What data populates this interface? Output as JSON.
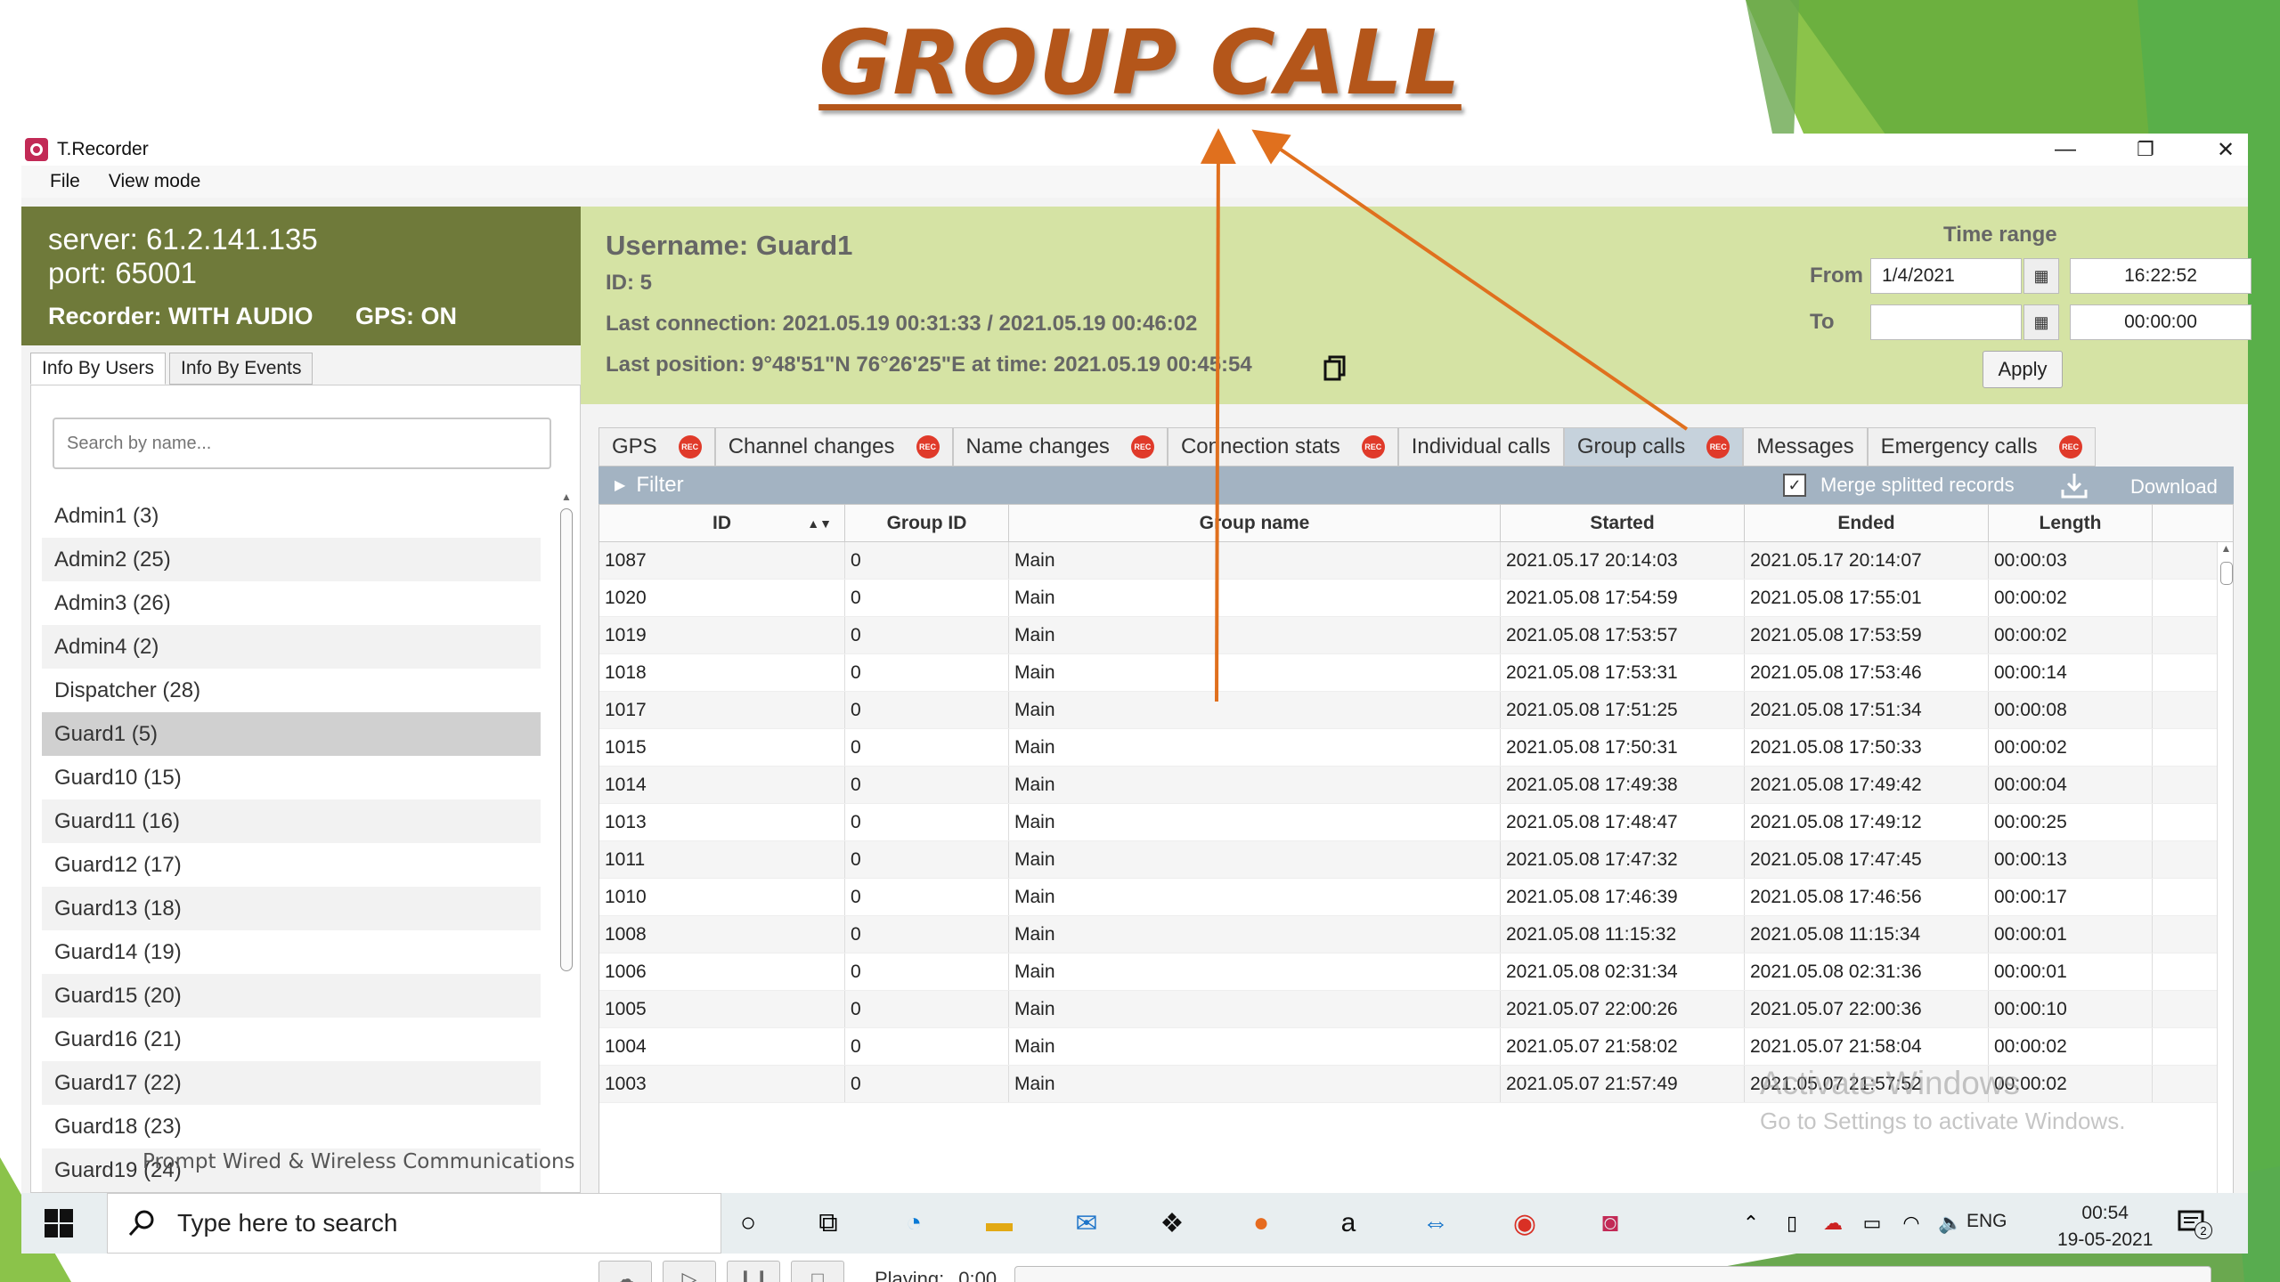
{
  "slide": {
    "title": "GROUP CALL",
    "accent_color": "#b4561a",
    "green_colors": [
      "#8bc34a",
      "#6aa84f",
      "#4caf50"
    ]
  },
  "window": {
    "title": "T.Recorder",
    "minimize": "—",
    "restore": "❐",
    "close": "✕"
  },
  "menu": {
    "items": [
      "File",
      "View mode"
    ]
  },
  "server": {
    "address": "server: 61.2.141.135",
    "port": "port: 65001",
    "recorder": "Recorder: WITH AUDIO",
    "gps": "GPS: ON"
  },
  "left_tabs": [
    "Info By Users",
    "Info By Events"
  ],
  "search": {
    "placeholder": "Search by name..."
  },
  "users": [
    "Admin1 (3)",
    "Admin2 (25)",
    "Admin3 (26)",
    "Admin4 (2)",
    "Dispatcher (28)",
    "Guard1 (5)",
    "Guard10 (15)",
    "Guard11 (16)",
    "Guard12 (17)",
    "Guard13 (18)",
    "Guard14 (19)",
    "Guard15 (20)",
    "Guard16 (21)",
    "Guard17 (22)",
    "Guard18 (23)",
    "Guard19 (24)"
  ],
  "footer": "Prompt Wired & Wireless Communications",
  "info": {
    "username": "Username: Guard1",
    "id": "ID: 5",
    "last_connection": "Last connection: 2021.05.19 00:31:33 / 2021.05.19 00:46:02",
    "last_position": "Last position: 9°48'51\"N 76°26'25\"E at time: 2021.05.19 00:45:54"
  },
  "time_range": {
    "title": "Time range",
    "from_label": "From",
    "to_label": "To",
    "from_date": "1/4/2021",
    "from_time": "16:22:52",
    "to_date": "",
    "to_time": "00:00:00",
    "apply": "Apply"
  },
  "tabs": [
    {
      "label": "GPS",
      "rec": true
    },
    {
      "label": "Channel changes",
      "rec": true
    },
    {
      "label": "Name changes",
      "rec": true
    },
    {
      "label": "Connection stats",
      "rec": true
    },
    {
      "label": "Individual calls",
      "rec": false
    },
    {
      "label": "Group calls",
      "rec": true
    },
    {
      "label": "Messages",
      "rec": false
    },
    {
      "label": "Emergency calls",
      "rec": true
    }
  ],
  "rec_badge": "REC",
  "filter": {
    "label": "Filter",
    "merge": "Merge splitted records",
    "download": "Download"
  },
  "table": {
    "columns": [
      "ID",
      "Group ID",
      "Group name",
      "Started",
      "Ended",
      "Length"
    ],
    "rows": [
      [
        "1087",
        "0",
        "Main",
        "2021.05.17 20:14:03",
        "2021.05.17 20:14:07",
        "00:00:03"
      ],
      [
        "1020",
        "0",
        "Main",
        "2021.05.08 17:54:59",
        "2021.05.08 17:55:01",
        "00:00:02"
      ],
      [
        "1019",
        "0",
        "Main",
        "2021.05.08 17:53:57",
        "2021.05.08 17:53:59",
        "00:00:02"
      ],
      [
        "1018",
        "0",
        "Main",
        "2021.05.08 17:53:31",
        "2021.05.08 17:53:46",
        "00:00:14"
      ],
      [
        "1017",
        "0",
        "Main",
        "2021.05.08 17:51:25",
        "2021.05.08 17:51:34",
        "00:00:08"
      ],
      [
        "1015",
        "0",
        "Main",
        "2021.05.08 17:50:31",
        "2021.05.08 17:50:33",
        "00:00:02"
      ],
      [
        "1014",
        "0",
        "Main",
        "2021.05.08 17:49:38",
        "2021.05.08 17:49:42",
        "00:00:04"
      ],
      [
        "1013",
        "0",
        "Main",
        "2021.05.08 17:48:47",
        "2021.05.08 17:49:12",
        "00:00:25"
      ],
      [
        "1011",
        "0",
        "Main",
        "2021.05.08 17:47:32",
        "2021.05.08 17:47:45",
        "00:00:13"
      ],
      [
        "1010",
        "0",
        "Main",
        "2021.05.08 17:46:39",
        "2021.05.08 17:46:56",
        "00:00:17"
      ],
      [
        "1008",
        "0",
        "Main",
        "2021.05.08 11:15:32",
        "2021.05.08 11:15:34",
        "00:00:01"
      ],
      [
        "1006",
        "0",
        "Main",
        "2021.05.08 02:31:34",
        "2021.05.08 02:31:36",
        "00:00:01"
      ],
      [
        "1005",
        "0",
        "Main",
        "2021.05.07 22:00:26",
        "2021.05.07 22:00:36",
        "00:00:10"
      ],
      [
        "1004",
        "0",
        "Main",
        "2021.05.07 21:58:02",
        "2021.05.07 21:58:04",
        "00:00:02"
      ],
      [
        "1003",
        "0",
        "Main",
        "2021.05.07 21:57:49",
        "2021.05.07 21:57:52",
        "00:00:02"
      ]
    ]
  },
  "player": {
    "playing_label": "Playing:",
    "time": "0:00"
  },
  "watermark": {
    "line1": "Activate Windows",
    "line2": "Go to Settings to activate Windows."
  },
  "taskbar": {
    "search_placeholder": "Type here to search",
    "lang": "ENG",
    "time": "00:54",
    "date": "19-05-2021",
    "notifications": "2"
  }
}
